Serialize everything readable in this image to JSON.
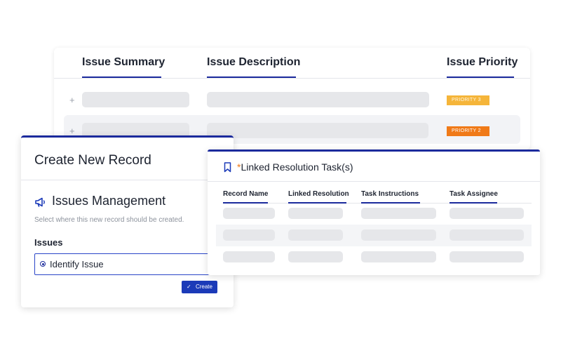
{
  "issues_table": {
    "headers": [
      "Issue Summary",
      "Issue Description",
      "Issue Priority"
    ],
    "rows": [
      {
        "expand_glyph": "+",
        "priority": "PRIORITY 3",
        "priority_color": "#f5b53a"
      },
      {
        "expand_glyph": "+",
        "priority": "PRIORITY 2",
        "priority_color": "#f07a18"
      }
    ]
  },
  "create_record": {
    "title": "Create New Record",
    "app_icon": "megaphone-icon",
    "app_name": "Issues Management",
    "helper_text": "Select where this new record should be created.",
    "section_label": "Issues",
    "selected_option": "Identify Issue",
    "create_button": {
      "check_icon": "✓",
      "label": "Create"
    }
  },
  "linked_tasks": {
    "icon": "bookmark-icon",
    "required_marker": "*",
    "title": "Linked Resolution Task(s)",
    "headers": [
      "Record Name",
      "Linked Resolution",
      "Task Instructions",
      "Task Assignee"
    ]
  },
  "colors": {
    "accent": "#1b2a9c",
    "button": "#1b3ab8",
    "priority_3": "#f5b53a",
    "priority_2": "#f07a18",
    "required": "#f07a18"
  }
}
